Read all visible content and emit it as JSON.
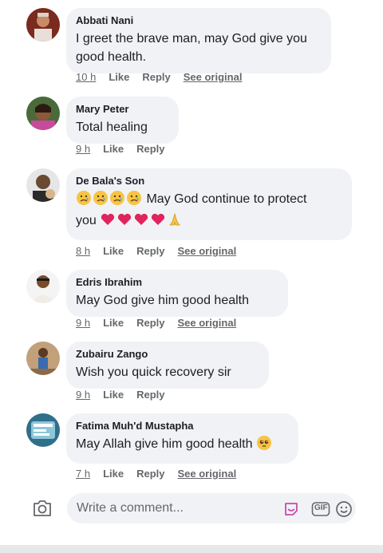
{
  "comments": [
    {
      "author": "Abbati Nani",
      "line1": "I greet the brave man, may God give you",
      "line2": "good health.",
      "time": "10 h",
      "like": "Like",
      "reply": "Reply",
      "see_original": "See original"
    },
    {
      "author": "Mary Peter",
      "line1": "Total healing",
      "time": "9 h",
      "like": "Like",
      "reply": "Reply"
    },
    {
      "author": "De Bala's Son",
      "line1": "May God continue to protect",
      "line2": "you",
      "time": "8 h",
      "like": "Like",
      "reply": "Reply",
      "see_original": "See original"
    },
    {
      "author": "Edris Ibrahim",
      "line1": "May God give him good health",
      "time": "9 h",
      "like": "Like",
      "reply": "Reply",
      "see_original": "See original"
    },
    {
      "author": "Zubairu Zango",
      "line1": "Wish you quick recovery sir",
      "time": "9 h",
      "like": "Like",
      "reply": "Reply"
    },
    {
      "author": "Fatima Muh'd Mustapha",
      "line1": "May Allah give him good health",
      "time": "7 h",
      "like": "Like",
      "reply": "Reply",
      "see_original": "See original"
    }
  ],
  "composer": {
    "placeholder": "Write a comment...",
    "gif_label": "GIF",
    "camera_icon": "camera-icon",
    "sticker_icon": "sticker-icon",
    "gif_icon": "gif-icon",
    "emoji_icon": "smiley-icon"
  },
  "colors": {
    "bubble": "#f0f2f5",
    "text": "#1c1e21",
    "meta": "#65676b",
    "heart": "#e0245e",
    "emoji_yellow": "#f7c443"
  }
}
